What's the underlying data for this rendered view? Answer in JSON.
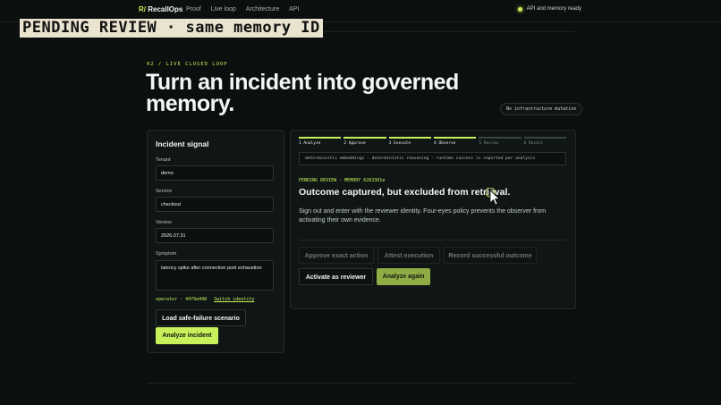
{
  "nav": {
    "brand_mark": "R/",
    "brand_name": "RecallOps",
    "links": [
      "Proof",
      "Live loop",
      "Architecture",
      "API"
    ],
    "status": "API and memory ready"
  },
  "banner": "PENDING REVIEW · same memory ID",
  "hero": {
    "eyebrow": "02 / LIVE CLOSED LOOP",
    "headline": "Turn an incident into governed memory.",
    "pill": "No infrastructure mutation"
  },
  "incident": {
    "title": "Incident signal",
    "fields": [
      {
        "label": "Tenant",
        "value": "demo"
      },
      {
        "label": "Service",
        "value": "checkout"
      },
      {
        "label": "Version",
        "value": "2026.07.31"
      },
      {
        "label": "Symptom",
        "value": "latency spike after connection pool exhaustion"
      }
    ],
    "operator": "operator · 4479a448",
    "switch_identity": "Switch identity",
    "load_button": "Load safe-failure scenario",
    "analyze_button": "Analyze incident"
  },
  "workflow": {
    "steps": [
      {
        "label": "1 Analyze",
        "done": true
      },
      {
        "label": "2 Approve",
        "done": true
      },
      {
        "label": "3 Execute",
        "done": true
      },
      {
        "label": "4 Observe",
        "done": true
      },
      {
        "label": "5 Review",
        "done": false
      },
      {
        "label": "6 Recall",
        "done": false
      }
    ],
    "subbar": "deterministic embeddings · deterministic reasoning · runtime success is reported per analysis",
    "pending": "PENDING REVIEW · MEMORY 6263301e",
    "outcome_title": "Outcome captured, but excluded from retrieval.",
    "outcome_desc": "Sign out and enter with the reviewer identity. Four-eyes policy prevents the observer from activating their own evidence.",
    "buttons": {
      "approve_exact": "Approve exact action",
      "attest": "Attest execution",
      "record": "Record successful outcome",
      "activate": "Activate as reviewer",
      "analyze_again": "Analyze again"
    }
  },
  "colors": {
    "accent": "#c8f05a",
    "background": "#0b0f0e",
    "panel": "#101615"
  }
}
